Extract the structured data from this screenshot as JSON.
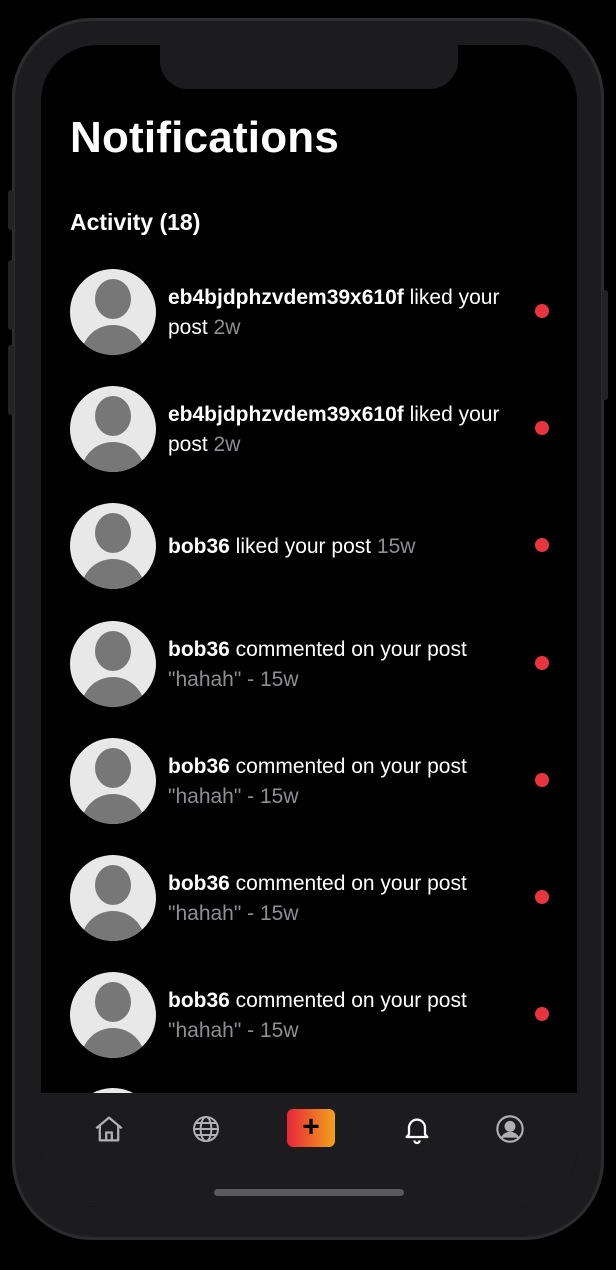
{
  "header": {
    "title": "Notifications"
  },
  "section": {
    "title": "Activity (18)"
  },
  "notifications": [
    {
      "user": "eb4bjdphzvdem39x610f",
      "action": " liked your post",
      "meta": " 2w"
    },
    {
      "user": "eb4bjdphzvdem39x610f",
      "action": " liked your post",
      "meta": " 2w"
    },
    {
      "user": "bob36",
      "action": " liked your post",
      "meta": " 15w"
    },
    {
      "user": "bob36",
      "action": " commented on your post",
      "meta": "\"hahah\" - 15w"
    },
    {
      "user": "bob36",
      "action": " commented on your post",
      "meta": "\"hahah\" - 15w"
    },
    {
      "user": "bob36",
      "action": " commented on your post",
      "meta": "\"hahah\" - 15w"
    },
    {
      "user": "bob36",
      "action": " commented on your post",
      "meta": "\"hahah\" - 15w"
    }
  ],
  "tabbar": {
    "plus_label": "+",
    "tabs": [
      "home-icon",
      "globe-icon",
      "create-post-icon",
      "bell-icon",
      "profile-icon"
    ]
  },
  "colors": {
    "unread_dot": "#e8343f",
    "muted_text": "#8e8e93",
    "tabbar_bg": "#1c1c1e"
  }
}
